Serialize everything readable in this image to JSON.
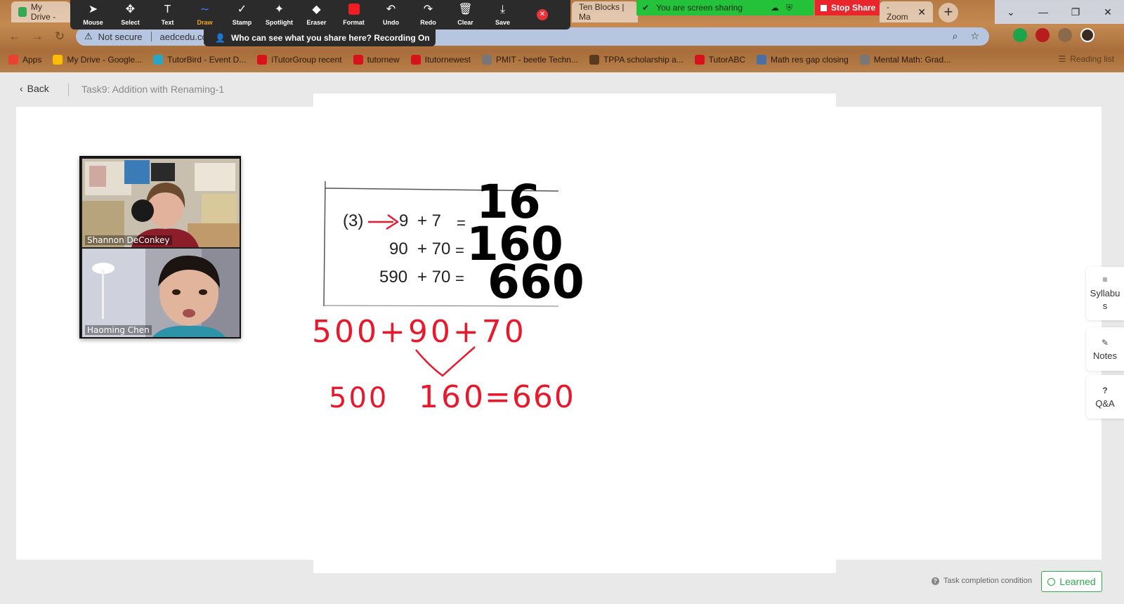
{
  "browser": {
    "tabs": [
      {
        "label": "My Drive -",
        "favicon_color": "#34a853"
      },
      {
        "label": "Ten Blocks | Ma",
        "favicon_color": "#6a7bd8"
      },
      {
        "label": "- Zoom",
        "favicon_color": "#2d8cff"
      }
    ],
    "address": {
      "security": "Not secure",
      "url": "aedcedu.co"
    },
    "bookmarks": [
      {
        "label": "Apps",
        "color": "#e94235"
      },
      {
        "label": "My Drive - Google...",
        "color": "#fbbc04"
      },
      {
        "label": "TutorBird - Event D...",
        "color": "#2aa6c4"
      },
      {
        "label": "iTutorGroup recent",
        "color": "#d8121a"
      },
      {
        "label": "tutornew",
        "color": "#d8121a"
      },
      {
        "label": "Itutornewest",
        "color": "#d8121a"
      },
      {
        "label": "PMIT - beetle Techn...",
        "color": "#777777"
      },
      {
        "label": "TPPA scholarship a...",
        "color": "#5a3a1a"
      },
      {
        "label": "TutorABC",
        "color": "#d8121a"
      },
      {
        "label": "Math res gap closing",
        "color": "#4a6fa5"
      },
      {
        "label": "Mental Math: Grad...",
        "color": "#777777"
      }
    ],
    "reading_list": "Reading list"
  },
  "zoom": {
    "tools": [
      {
        "label": "Mouse",
        "icon": "cursor-icon",
        "glyph": "➤"
      },
      {
        "label": "Select",
        "icon": "move-icon",
        "glyph": "✥"
      },
      {
        "label": "Text",
        "icon": "text-icon",
        "glyph": "T"
      },
      {
        "label": "Draw",
        "icon": "draw-icon",
        "glyph": "∼"
      },
      {
        "label": "Stamp",
        "icon": "stamp-icon",
        "glyph": "✓"
      },
      {
        "label": "Spotlight",
        "icon": "spotlight-icon",
        "glyph": "✦"
      },
      {
        "label": "Eraser",
        "icon": "eraser-icon",
        "glyph": "◆"
      },
      {
        "label": "Format",
        "icon": "format-icon",
        "glyph": ""
      },
      {
        "label": "Undo",
        "icon": "undo-icon",
        "glyph": "↶"
      },
      {
        "label": "Redo",
        "icon": "redo-icon",
        "glyph": "↷"
      },
      {
        "label": "Clear",
        "icon": "trash-icon",
        "glyph": "🗑"
      },
      {
        "label": "Save",
        "icon": "save-icon",
        "glyph": "⤓"
      }
    ],
    "active_tool": "Draw",
    "who_can_see": "Who can see what you share here? Recording On",
    "sharing_text": "You are screen sharing",
    "stop_share": "Stop Share"
  },
  "page": {
    "back": "Back",
    "task_title": "Task9:  Addition with Renaming-1",
    "side_panel": [
      {
        "label": "Syllabus",
        "icon": "menu-icon",
        "glyph": "≡"
      },
      {
        "label": "Notes",
        "icon": "pencil-icon",
        "glyph": "✎"
      },
      {
        "label": "Q&A",
        "icon": "question-icon",
        "glyph": "?"
      }
    ],
    "task_condition": "Task completion condition",
    "learned": "Learned"
  },
  "video": [
    {
      "name": "Shannon DeConkey"
    },
    {
      "name": "Haoming Chen"
    }
  ],
  "worksheet": {
    "problem_number": "(3)",
    "rows": [
      {
        "expr_a": "9",
        "op": "+ 7",
        "eq": "=",
        "answer": "16"
      },
      {
        "expr_a": "90",
        "op": "+ 70",
        "eq": "=",
        "answer": "160"
      },
      {
        "expr_a": "590",
        "op": "+ 70",
        "eq": "=",
        "answer": "660"
      }
    ],
    "handwriting": {
      "line1": "500+90+70",
      "line2_a": "500",
      "line2_b": "160",
      "line2_c": "=660"
    },
    "ink_color": "#e8192c"
  }
}
